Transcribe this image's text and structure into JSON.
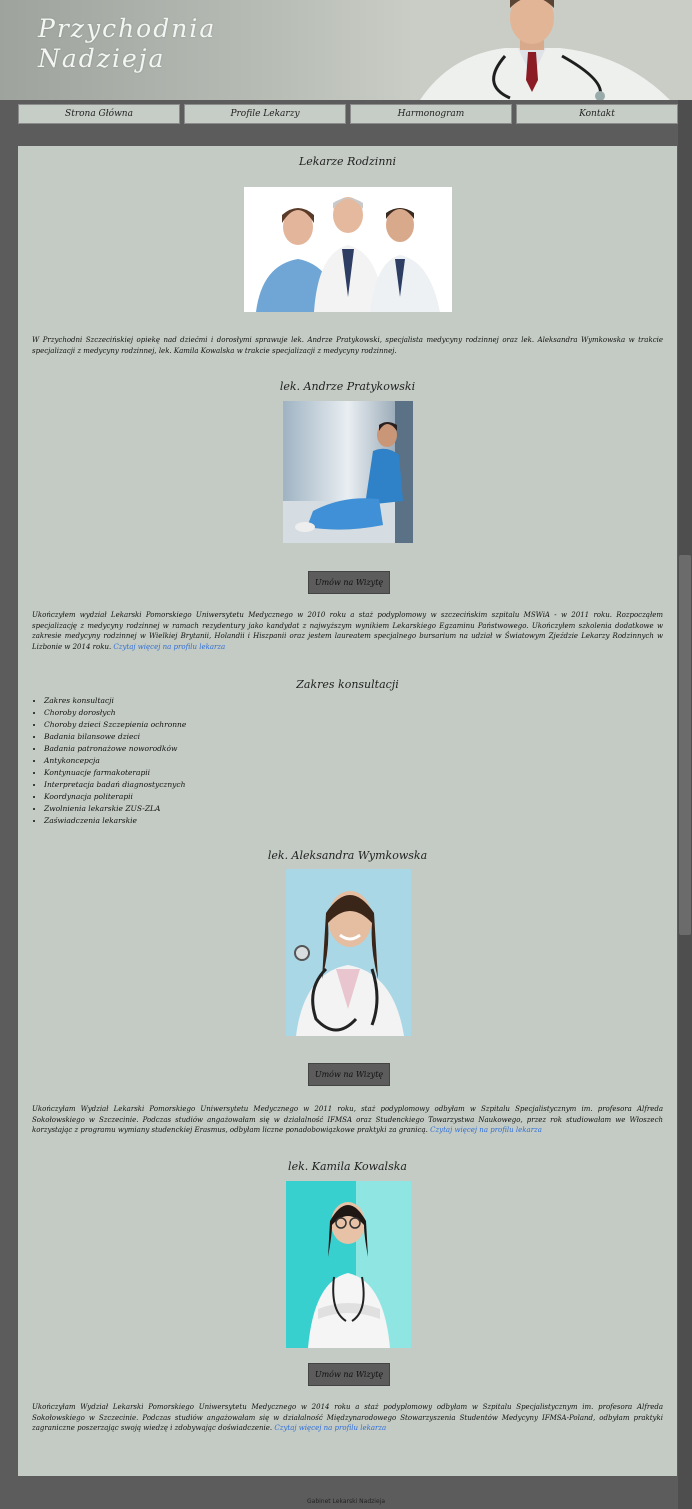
{
  "header": {
    "title": "Przychodnia\nNadzieja"
  },
  "nav": {
    "items": [
      {
        "label": "Strona Główna"
      },
      {
        "label": "Profile Lekarzy"
      },
      {
        "label": "Harmonogram"
      },
      {
        "label": "Kontakt"
      }
    ]
  },
  "intro": {
    "title": "Lekarze Rodzinni",
    "text": "W Przychodni Szczecińskiej opiekę nad dziećmi i dorosłymi sprawuje lek. Andrze Pratykowski, specjalista medycyny rodzinnej oraz lek. Aleksandra Wymkowska w trakcie specjalizacji z medycyny rodzinnej, lek. Kamila Kowalska w trakcie specjalizacji z medycyny rodzinnej."
  },
  "doctors": [
    {
      "name": "lek. Andrze Pratykowski",
      "button": "Umów na Wizytę",
      "bio": "Ukończyłem wydział Lekarski Pomorskiego Uniwersytetu Medycznego w 2010 roku a staż podyplomowy w szczecińskim szpitalu MSWiA - w 2011 roku. Rozpocząłem specjalizację z medycyny rodzinnej w ramach rezydentury jako kandydat z najwyższym wynikiem Lekarskiego Egzaminu Państwowego. Ukończyłem szkolenia dodatkowe w zakresie medycyny rodzinnej w Wielkiej Brytanii, Holandii i Hiszpanii oraz jestem laureatem specjalnego bursarium na udział w Światowym Zjeździe Lekarzy Rodzinnych w Lizbonie w 2014 roku.",
      "link": "Czytaj więcej na profilu lekarza"
    },
    {
      "name": "lek. Aleksandra Wymkowska",
      "button": "Umów na Wizytę",
      "bio": "Ukończyłam Wydział Lekarski Pomorskiego Uniwersytetu Medycznego w 2011 roku, staż podyplomowy odbyłam w Szpitalu Specjalistycznym im. profesora Alfreda Sokołowskiego w Szczecinie. Podczas studiów angażowałam się w działalność IFMSA oraz Studenckiego Towarzystwa Naukowego, przez rok studiowałam we Włoszech korzystając z programu wymiany studenckiej Erasmus, odbyłam liczne ponadobowiązkowe praktyki za granicą.",
      "link": "Czytaj więcej na profilu lekarza"
    },
    {
      "name": "lek. Kamila Kowalska",
      "button": "Umów na Wizytę",
      "bio": "Ukończyłam Wydział Lekarski Pomorskiego Uniwersytetu Medycznego w 2014 roku a staż podyplomowy odbyłam w Szpitalu Specjalistycznym im. profesora Alfreda Sokołowskiego w Szczecinie. Podczas studiów angażowałam się w działalność Międzynarodowego Stowarzyszenia Studentów Medycyny IFMSA-Poland, odbyłam praktyki zagraniczne poszerzając swoją wiedzę i zdobywając doświadczenie.",
      "link": "Czytaj więcej na profilu lekarza"
    }
  ],
  "consultations": {
    "title": "Zakres konsultacji",
    "items": [
      "Zakres konsultacji",
      "Choroby dorosłych",
      "Choroby dzieci Szczepienia ochronne",
      "Badania bilansowe dzieci",
      "Badania patronażowe noworodków",
      "Antykoncepcja",
      "Kontynuacje farmakoterapii",
      "Interpretacja badań diagnostycznych",
      "Koordynacja politerapii",
      "Zwolnienia lekarskie ZUS-ZLA",
      "Zaświadczenia lekarskie"
    ]
  },
  "footer": {
    "text": "Gabinet Lekarski Nadzieja"
  },
  "colors": {
    "background": "#5c5c5c",
    "panel": "#c4cbc4",
    "nav_button": "#c6ccc6",
    "link": "#2f6fd6",
    "button": "#5c5c5c"
  }
}
